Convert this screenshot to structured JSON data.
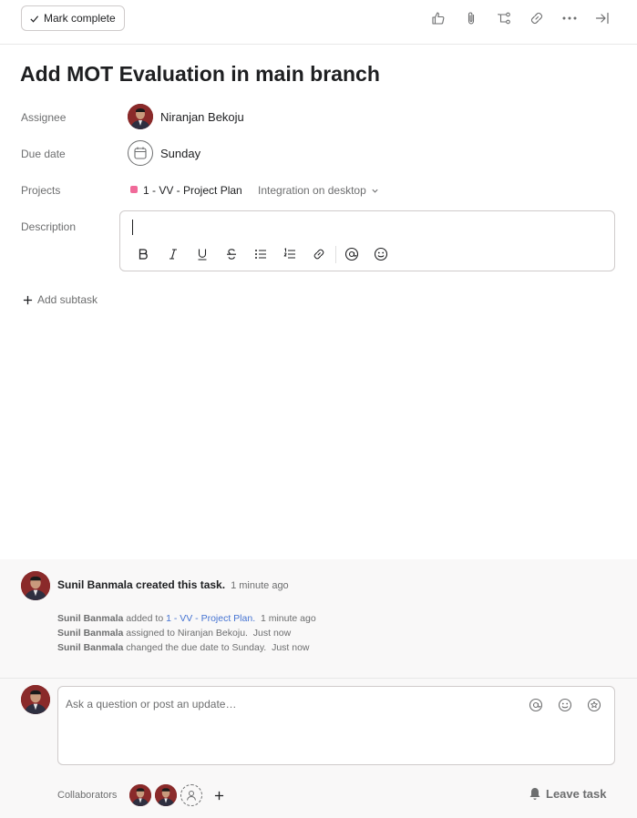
{
  "toolbar": {
    "mark_complete_label": "Mark complete",
    "icons": [
      "thumbs-up-icon",
      "paperclip-icon",
      "subtask-icon",
      "link-icon",
      "more-icon",
      "close-pane-icon"
    ]
  },
  "task": {
    "title": "Add MOT Evaluation in main branch"
  },
  "fields": {
    "assignee_label": "Assignee",
    "assignee_name": "Niranjan Bekoju",
    "due_date_label": "Due date",
    "due_date_value": "Sunday",
    "projects_label": "Projects",
    "project_name": "1 - VV - Project Plan",
    "project_color": "#f06a99",
    "section_name": "Integration on desktop",
    "description_label": "Description",
    "description_value": ""
  },
  "description_toolbar": [
    "bold-icon",
    "italic-icon",
    "underline-icon",
    "strikethrough-icon",
    "bullet-list-icon",
    "numbered-list-icon",
    "link-icon",
    "mention-icon",
    "emoji-icon"
  ],
  "subtasks": {
    "add_label": "Add subtask"
  },
  "activity": {
    "created_by": "Sunil Banmala created this task.",
    "created_time": "1 minute ago",
    "entries": [
      {
        "actor": "Sunil Banmala",
        "action": "added to",
        "target": "1 - VV - Project Plan.",
        "time": "1 minute ago"
      },
      {
        "actor": "Sunil Banmala",
        "action": "assigned to Niranjan Bekoju.",
        "time": "Just now"
      },
      {
        "actor": "Sunil Banmala",
        "action": "changed the due date to Sunday.",
        "time": "Just now"
      }
    ]
  },
  "comment": {
    "placeholder": "Ask a question or post an update…"
  },
  "collaborators": {
    "label": "Collaborators",
    "leave_label": "Leave task"
  },
  "colors": {
    "accent_link": "#4573d2",
    "avatar_bg": "#7a1e22"
  }
}
